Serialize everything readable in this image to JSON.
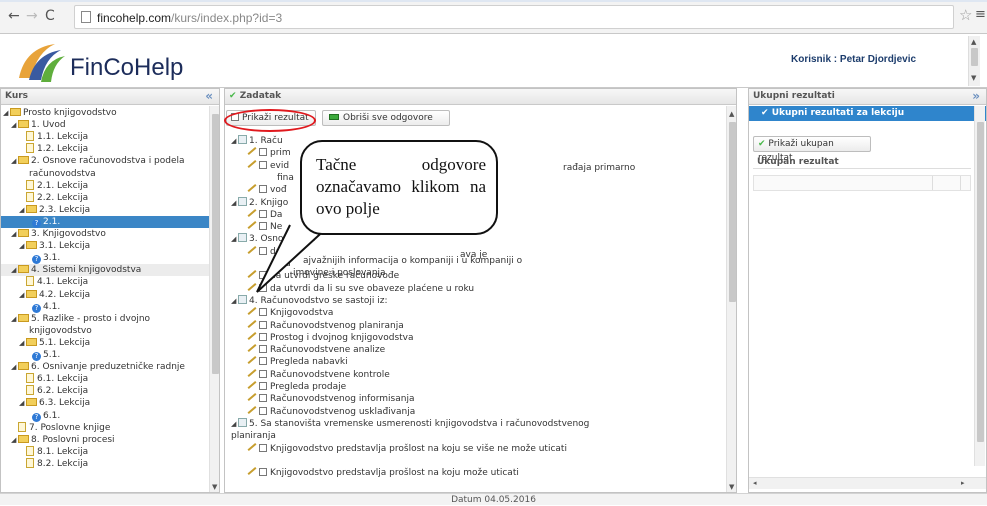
{
  "browser": {
    "url_host": "fincohelp.com",
    "url_path": "/kurs/index.php?id=3"
  },
  "header": {
    "logo_text": "FinCoHelp",
    "user": "Korisnik : Petar Djordjevic"
  },
  "left_panel": {
    "title": "Kurs",
    "tree": [
      {
        "label": "Prosto knjigovodstvo",
        "level": 0,
        "kind": "folder",
        "state": ""
      },
      {
        "label": "1. Uvod",
        "level": 1,
        "kind": "folder",
        "state": ""
      },
      {
        "label": "1.1. Lekcija",
        "level": 2,
        "kind": "doc",
        "state": ""
      },
      {
        "label": "1.2. Lekcija",
        "level": 2,
        "kind": "doc",
        "state": ""
      },
      {
        "label": "2. Osnove računovodstva i podela",
        "level": 1,
        "kind": "folder",
        "state": ""
      },
      {
        "label": "računovodstva",
        "level": 1,
        "kind": "cont",
        "state": ""
      },
      {
        "label": "2.1. Lekcija",
        "level": 2,
        "kind": "doc",
        "state": ""
      },
      {
        "label": "2.2. Lekcija",
        "level": 2,
        "kind": "doc",
        "state": ""
      },
      {
        "label": "2.3. Lekcija",
        "level": 2,
        "kind": "folder",
        "state": ""
      },
      {
        "label": "2.1.",
        "level": 3,
        "kind": "quiz",
        "state": "selected"
      },
      {
        "label": "3. Knjigovodstvo",
        "level": 1,
        "kind": "folder",
        "state": ""
      },
      {
        "label": "3.1. Lekcija",
        "level": 2,
        "kind": "folder",
        "state": ""
      },
      {
        "label": "3.1.",
        "level": 3,
        "kind": "quiz",
        "state": ""
      },
      {
        "label": "4. Sistemi knjigovodstva",
        "level": 1,
        "kind": "folder",
        "state": "highlight"
      },
      {
        "label": "4.1. Lekcija",
        "level": 2,
        "kind": "doc",
        "state": ""
      },
      {
        "label": "4.2. Lekcija",
        "level": 2,
        "kind": "folder",
        "state": ""
      },
      {
        "label": "4.1.",
        "level": 3,
        "kind": "quiz",
        "state": ""
      },
      {
        "label": "5. Razlike - prosto i dvojno",
        "level": 1,
        "kind": "folder",
        "state": ""
      },
      {
        "label": "knjigovodstvo",
        "level": 1,
        "kind": "cont",
        "state": ""
      },
      {
        "label": "5.1. Lekcija",
        "level": 2,
        "kind": "folder",
        "state": ""
      },
      {
        "label": "5.1.",
        "level": 3,
        "kind": "quiz",
        "state": ""
      },
      {
        "label": "6. Osnivanje preduzetničke radnje",
        "level": 1,
        "kind": "folder",
        "state": ""
      },
      {
        "label": "6.1. Lekcija",
        "level": 2,
        "kind": "doc",
        "state": ""
      },
      {
        "label": "6.2. Lekcija",
        "level": 2,
        "kind": "doc",
        "state": ""
      },
      {
        "label": "6.3. Lekcija",
        "level": 2,
        "kind": "folder",
        "state": ""
      },
      {
        "label": "6.1.",
        "level": 3,
        "kind": "quiz",
        "state": ""
      },
      {
        "label": "7. Poslovne knjige",
        "level": 1,
        "kind": "doc",
        "state": ""
      },
      {
        "label": "8. Poslovni procesi",
        "level": 1,
        "kind": "folder",
        "state": ""
      },
      {
        "label": "8.1. Lekcija",
        "level": 2,
        "kind": "doc",
        "state": ""
      },
      {
        "label": "8.2. Lekcija",
        "level": 2,
        "kind": "doc",
        "state": ""
      }
    ]
  },
  "middle_panel": {
    "title": "Zadatak",
    "show_result_label": "Prikaži rezultat",
    "clear_answers_label": "Obriši sve odgovore",
    "rows": [
      {
        "text": "1. Raču",
        "kind": "question"
      },
      {
        "text": "prim",
        "kind": "answer"
      },
      {
        "text": "evid",
        "kind": "answer"
      },
      {
        "text": "fina",
        "kind": "cont"
      },
      {
        "text": "vođ",
        "kind": "answer"
      },
      {
        "text": "2. Knjigo",
        "kind": "question"
      },
      {
        "text": "Da",
        "kind": "answer"
      },
      {
        "text": "Ne",
        "kind": "answer"
      },
      {
        "text": "3. Osnovna svr",
        "kind": "question"
      },
      {
        "text": "da pru",
        "kind": "answer"
      },
      {
        "text": "sta",
        "kind": "cont"
      },
      {
        "text": "da utvrdi greške računovođe",
        "kind": "answer"
      },
      {
        "text": "da utvrdi da li su sve obaveze plaćene u roku",
        "kind": "answer"
      },
      {
        "text": "4. Računovodstvo se sastoji iz:",
        "kind": "question"
      },
      {
        "text": "Knjigovodstva",
        "kind": "answer"
      },
      {
        "text": "Računovodstvenog planiranja",
        "kind": "answer"
      },
      {
        "text": "Prostog i dvojnog knjigovodstva",
        "kind": "answer"
      },
      {
        "text": "Računovodstvene analize",
        "kind": "answer"
      },
      {
        "text": "Pregleda nabavki",
        "kind": "answer"
      },
      {
        "text": "Računovodstvene kontrole",
        "kind": "answer"
      },
      {
        "text": "Pregleda prodaje",
        "kind": "answer"
      },
      {
        "text": "Računovodstvenog informisanja",
        "kind": "answer"
      },
      {
        "text": "Računovodstvenog usklađivanja",
        "kind": "answer"
      },
      {
        "text": "5. Sa stanovišta vremenske usmerenosti knjigovodstva i računovodstvenog",
        "kind": "question"
      },
      {
        "text": "planiranja",
        "kind": "cont"
      },
      {
        "text": "Knjigovodstvo predstavlja prošlost na koju se više ne može uticati",
        "kind": "answer"
      },
      {
        "text": "",
        "kind": "blank"
      },
      {
        "text": "Knjigovodstvo predstavlja prošlost na koju može uticati",
        "kind": "answer"
      }
    ],
    "fragments": {
      "evid_tail": "rađaja primarno",
      "da_pru_tail": "ajvažnijih informacija o kompaniji i u kompaniji o",
      "sta_tail": "imovine i poslovanja",
      "svr_tail": "ava je"
    }
  },
  "callout": {
    "text": "Tačne odgovore označavamo klikom na ovo polje"
  },
  "right_panel": {
    "title": "Ukupni rezultati",
    "lesson_results": "Ukupni rezultati za lekciju",
    "show_total_label": "Prikaži ukupan rezultat",
    "total_heading": "Ukupan rezultat"
  },
  "footer": {
    "date": "Datum 04.05.2016"
  }
}
